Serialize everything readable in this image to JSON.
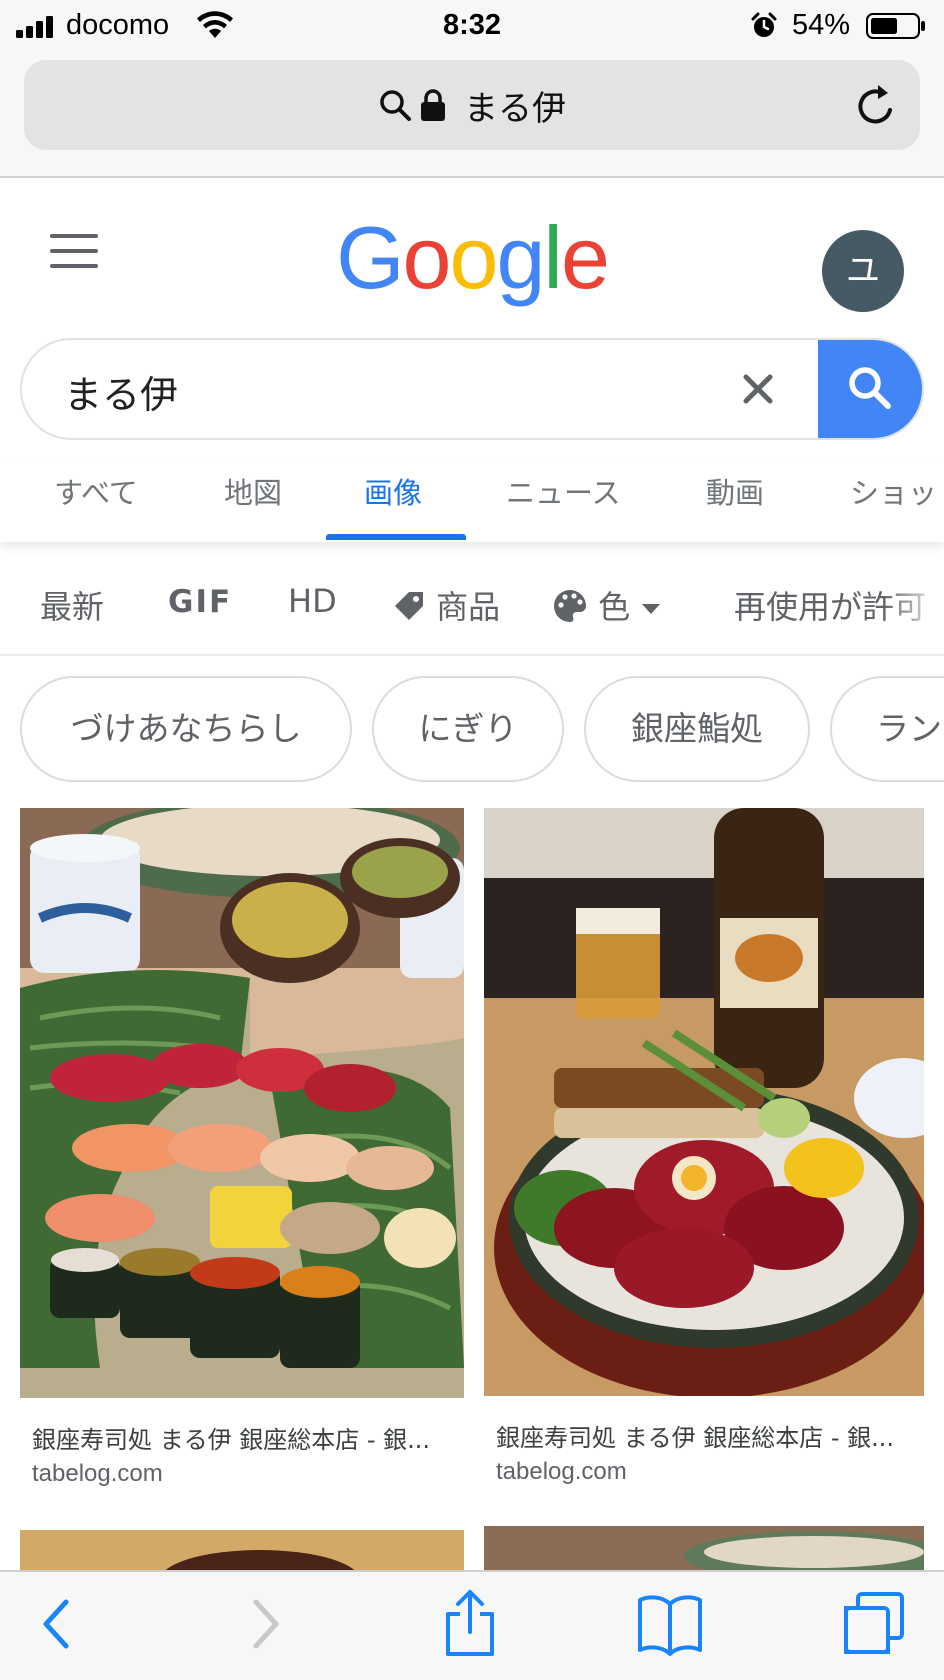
{
  "status_bar": {
    "carrier": "docomo",
    "time": "8:32",
    "battery": "54%"
  },
  "address_bar": {
    "text": "まる伊"
  },
  "header": {
    "logo": [
      "G",
      "o",
      "o",
      "g",
      "l",
      "e"
    ],
    "avatar_letter": "ユ"
  },
  "colors": {
    "google_blue": "#4285f4",
    "google_red": "#ea4335",
    "google_yellow": "#fbbc05",
    "google_green": "#34a853",
    "active_tab": "#1a73e8",
    "ios_blue": "#1a84ff"
  },
  "search": {
    "query": "まる伊"
  },
  "tabs": [
    {
      "label": "すべて",
      "active": false
    },
    {
      "label": "地図",
      "active": false
    },
    {
      "label": "画像",
      "active": true
    },
    {
      "label": "ニュース",
      "active": false
    },
    {
      "label": "動画",
      "active": false
    },
    {
      "label": "ショッ",
      "active": false
    }
  ],
  "filters": {
    "latest": "最新",
    "gif": "GIF",
    "hd": "HD",
    "products": "商品",
    "color": "色",
    "license": "再使用が許可"
  },
  "chips": [
    "づけあなちらし",
    "にぎり",
    "銀座鮨処",
    "ラン"
  ],
  "results": [
    {
      "title": "銀座寿司処 まる伊 銀座総本店 - 銀...",
      "site": "tabelog.com",
      "image": "sushi-platter-photo"
    },
    {
      "title": "銀座寿司処 まる伊 銀座総本店 - 銀...",
      "site": "tabelog.com",
      "image": "tuna-donburi-with-beer-photo"
    }
  ],
  "toolbar": {
    "icons": [
      "back-icon",
      "forward-icon",
      "share-icon",
      "bookmarks-icon",
      "tabs-icon"
    ]
  }
}
